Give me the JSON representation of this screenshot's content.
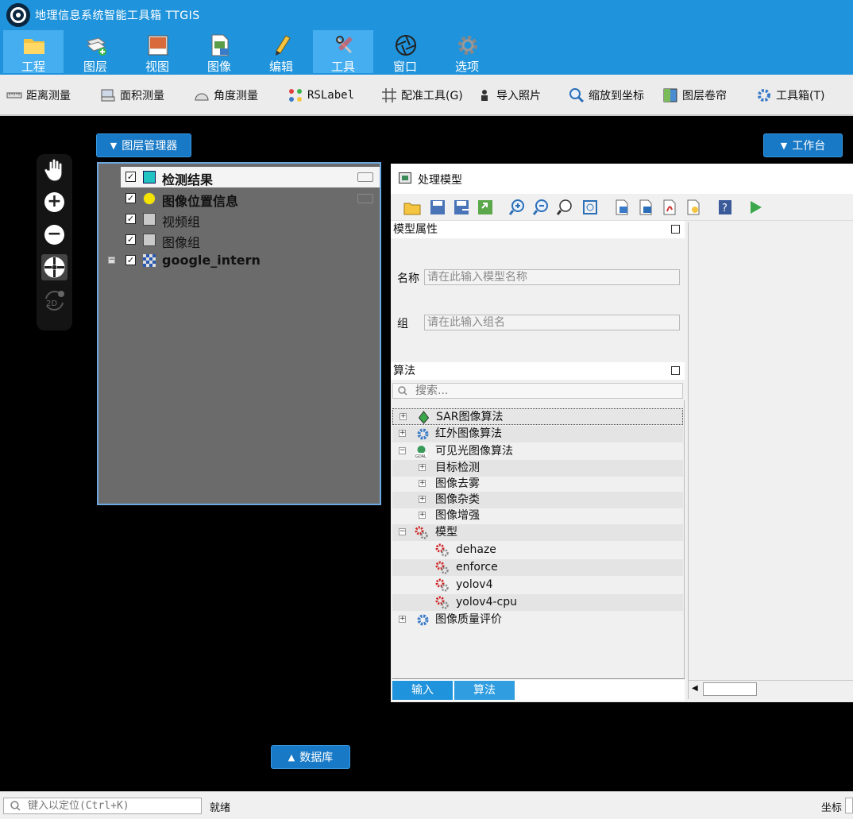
{
  "app": {
    "title": "地理信息系统智能工具箱 TTGIS"
  },
  "ribbon": [
    {
      "label": "工程",
      "icon": "folder-icon",
      "active": true
    },
    {
      "label": "图层",
      "icon": "layers-add-icon",
      "active": false
    },
    {
      "label": "视图",
      "icon": "map-view-icon",
      "active": false
    },
    {
      "label": "图像",
      "icon": "image-file-icon",
      "active": false
    },
    {
      "label": "编辑",
      "icon": "pencil-icon",
      "active": false
    },
    {
      "label": "工具",
      "icon": "tools-icon",
      "active": true
    },
    {
      "label": "窗口",
      "icon": "aperture-icon",
      "active": false
    },
    {
      "label": "选项",
      "icon": "gear-icon",
      "active": false
    }
  ],
  "toolbar": {
    "distance": "距离测量",
    "area": "面积测量",
    "angle": "角度测量",
    "rslabel": "RSLabel",
    "register": "配准工具(G)",
    "import_photo": "导入照片",
    "zoom_coord": "缩放到坐标",
    "swipe": "图层卷帘",
    "toolbox": "工具箱(T)"
  },
  "layer_manager": {
    "button": "图层管理器",
    "layers": [
      {
        "name": "检测结果",
        "checked": true,
        "bold": true,
        "selected": true
      },
      {
        "name": "图像位置信息",
        "checked": true,
        "bold": true
      },
      {
        "name": "视频组",
        "checked": true,
        "bold": false
      },
      {
        "name": "图像组",
        "checked": true,
        "bold": false
      },
      {
        "name": "google_intern",
        "checked": true,
        "bold": true
      }
    ]
  },
  "workbench": {
    "button": "工作台"
  },
  "database": {
    "button": "数据库"
  },
  "map_tools": {
    "mode_2d": "2D"
  },
  "model": {
    "title": "处理模型",
    "props_title": "模型属性",
    "name_label": "名称",
    "name_placeholder": "请在此输入模型名称",
    "group_label": "组",
    "group_placeholder": "请在此输入组名",
    "algo_title": "算法",
    "search_placeholder": "搜索...",
    "tree": [
      {
        "label": "SAR图像算法",
        "level": 0,
        "exp": "+"
      },
      {
        "label": "红外图像算法",
        "level": 0,
        "exp": "+"
      },
      {
        "label": "可见光图像算法",
        "level": 0,
        "exp": "-"
      },
      {
        "label": "目标检测",
        "level": 1,
        "exp": "+"
      },
      {
        "label": "图像去雾",
        "level": 1,
        "exp": "+"
      },
      {
        "label": "图像杂类",
        "level": 1,
        "exp": "+"
      },
      {
        "label": "图像增强",
        "level": 1,
        "exp": "+"
      },
      {
        "label": "模型",
        "level": 0,
        "exp": "-"
      },
      {
        "label": "dehaze",
        "level": 1,
        "exp": ""
      },
      {
        "label": "enforce",
        "level": 1,
        "exp": ""
      },
      {
        "label": "yolov4",
        "level": 1,
        "exp": ""
      },
      {
        "label": "yolov4-cpu",
        "level": 1,
        "exp": ""
      },
      {
        "label": "图像质量评价",
        "level": 0,
        "exp": "+"
      }
    ],
    "tabs": [
      "输入",
      "算法"
    ]
  },
  "status": {
    "locate_placeholder": "键入以定位(Ctrl+K)",
    "ready": "就绪",
    "coord_label": "坐标"
  },
  "colors": {
    "ribbon": "#1f93db",
    "accent": "#1879c6"
  }
}
